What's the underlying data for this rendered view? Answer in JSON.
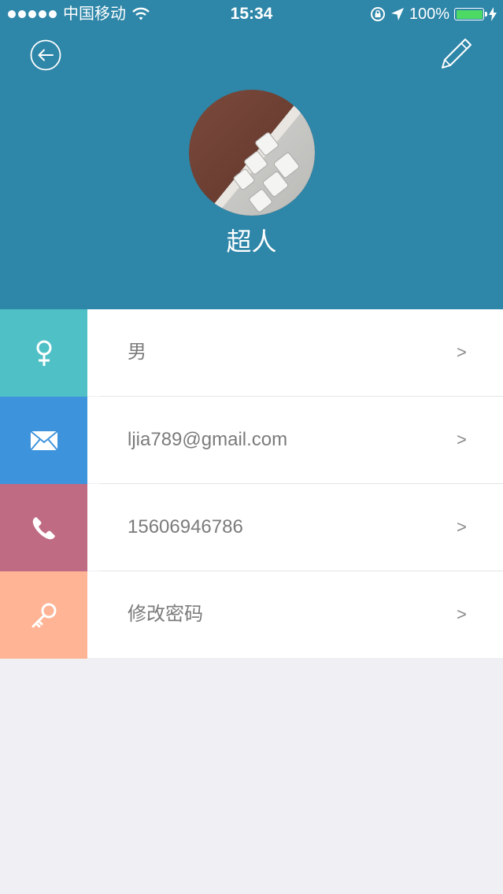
{
  "status_bar": {
    "carrier": "中国移动",
    "time": "15:34",
    "battery": "100%"
  },
  "profile": {
    "name": "超人"
  },
  "rows": [
    {
      "label": "男",
      "chevron": ">",
      "icon": "female-symbol-icon",
      "color": "#4fc0c6"
    },
    {
      "label": "ljia789@gmail.com",
      "chevron": ">",
      "icon": "mail-icon",
      "color": "#3e94dc"
    },
    {
      "label": "15606946786",
      "chevron": ">",
      "icon": "phone-icon",
      "color": "#c06b84"
    },
    {
      "label": "修改密码",
      "chevron": ">",
      "icon": "key-icon",
      "color": "#ffb495"
    }
  ],
  "colors": {
    "header": "#2e86a8",
    "background": "#efeff4"
  }
}
